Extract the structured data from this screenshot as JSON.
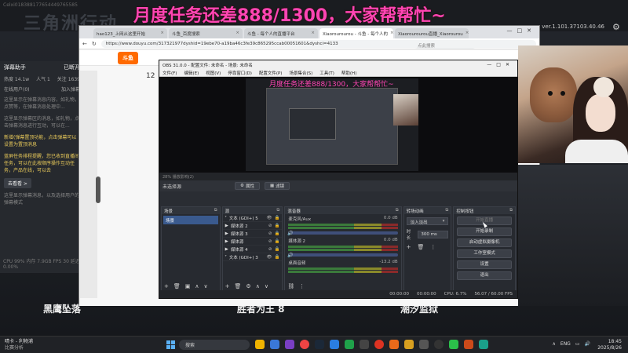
{
  "desktop": {
    "headline": "月度任务还差888/1300，大家帮帮忙~",
    "stream_id": "Celxi018388177654449765585",
    "bg_logo": "三角洲行动",
    "version": "ver.1.101.37103.40.46",
    "games": [
      "黑鹰坠落",
      "胜者为王 8",
      "潮汐监狱"
    ]
  },
  "danmaku": {
    "title": "弹幕助手",
    "status": "已断开",
    "hot_label": "热度 14.1w",
    "popularity": "人气 1",
    "gift": "关注 1639",
    "online_label": "在线用户(0)",
    "join_label": "加入弹幕",
    "msgs": [
      "这里显示在弹幕消息内容，如礼物，点赞等，在弹幕消息处理中...",
      "这里显示弹幕区的消息，如礼物，点击弹幕消息进行互动，可以在...",
      "新增(弹幕置顶功能，点击弹幕可以设置为置顶消息",
      "蓝屏任务排程提醒，您已收到直播间任务，可以在此按顺序操作互动任务，产品在线，可以去",
      "这里显示弹幕消息，以及选择用户的弹幕模式"
    ],
    "btn_more": "去看看 >",
    "bottom": "CPU 99%  内存 7.9GB  FPS 30  延迟 0.00%"
  },
  "browser": {
    "tabs": [
      "hao123_上网从这里开始",
      "斗鱼_百度搜索",
      "斗鱼 - 每个人的直播平台",
      "Xiaorourourou - 斗鱼 - 每个人的",
      "Xiaorourourou直播_Xiaorourou"
    ],
    "url": "https://www.douyu.com/317321977dyshid=19ebe70-a19ba46c3fe39c865295ccab00051601&dyshci=4133",
    "search_placeholder": "点此搜索",
    "logo": "斗鱼",
    "room_no": "12"
  },
  "obs": {
    "title": "OBS 31.0.0 - 配置文件: 未命名 - 场景: 未命名",
    "menu": [
      "文件(F)",
      "编辑(E)",
      "视图(V)",
      "停靠窗口(D)",
      "配置文件(P)",
      "场景集合(S)",
      "工具(T)",
      "帮助(H)"
    ],
    "preview_title": "月度任务还差888/1300，大家帮帮忙~",
    "preview_bar": "28%   播放影响(2)",
    "no_source": "未选择源",
    "props_label": "属性",
    "filters_label": "滤镜",
    "docks": {
      "scenes": {
        "title": "场景",
        "items": [
          "场景"
        ]
      },
      "sources": {
        "title": "源",
        "items": [
          "文本 (GDI+) 5",
          "媒体源 2",
          "媒体源 3",
          "媒体源",
          "媒体源 4",
          "文本 (GDI+) 3"
        ]
      },
      "mixer": {
        "title": "混音器",
        "channels": [
          {
            "name": "麦克风/Aux",
            "db": "0.0 dB"
          },
          {
            "name": "媒体源 2",
            "db": "0.0 dB"
          },
          {
            "name": "桌面音频",
            "db": "-13.2 dB"
          }
        ]
      },
      "transitions": {
        "title": "转场动画",
        "selected": "淡入淡出",
        "duration_label": "时长",
        "duration": "300 ms"
      },
      "controls": {
        "title": "控制按钮",
        "buttons": [
          "开始直播",
          "开始录制",
          "启动虚拟摄像机",
          "工作室模式",
          "设置",
          "退出"
        ]
      }
    },
    "status": {
      "time1": "00:00:00",
      "time2": "00:00:00",
      "cpu": "CPU: 6.7%",
      "fps": "56.07 / 60.00 FPS"
    }
  },
  "taskbar": {
    "weather_title": "晴卡 - 利物浦",
    "weather_sub": "比赛分析",
    "search": "搜索",
    "lang": "ENG",
    "time": "18:45",
    "date": "2025/8/26"
  },
  "colors": {
    "accent": "#ff45b4",
    "obs_bg": "#2a2d33",
    "scene_sel": "#3a5a8e"
  }
}
